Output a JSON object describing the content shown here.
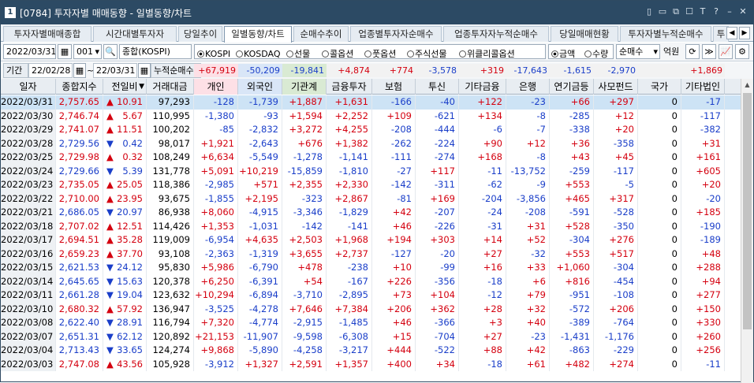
{
  "window": {
    "code": "1",
    "title": "[0784] 투자자별 매매동향 - 일별동향/차트",
    "controls": [
      "▯",
      "▭",
      "⧉",
      "☐",
      "T",
      "?",
      "–",
      "✕"
    ]
  },
  "tabs": [
    {
      "label": "투자자별매매종합",
      "active": false
    },
    {
      "label": "시간대별투자자",
      "active": false
    },
    {
      "label": "당일추이",
      "active": false
    },
    {
      "label": "일별동향/차트",
      "active": true
    },
    {
      "label": "순매수추이",
      "active": false
    },
    {
      "label": "업종별투자자순매수",
      "active": false
    },
    {
      "label": "업종투자자누적순매수",
      "active": false
    },
    {
      "label": "당일매매현황",
      "active": false
    },
    {
      "label": "투자자별누적순매수",
      "active": false
    },
    {
      "label": "투",
      "active": false
    }
  ],
  "tab_nav": {
    "prev": "◀",
    "next": "▶"
  },
  "toolbar": {
    "date": "2022/03/31",
    "calendar_icon": "▦",
    "sector_code": "001",
    "dropdown_icon": "▾",
    "search_icon": "🔍",
    "sector_name": "종합(KOSPI)",
    "market_radios": [
      {
        "label": "KOSPI",
        "checked": true
      },
      {
        "label": "KOSDAQ",
        "checked": false
      },
      {
        "label": "선물",
        "checked": false
      },
      {
        "label": "콜옵션",
        "checked": false
      },
      {
        "label": "풋옵션",
        "checked": false
      },
      {
        "label": "주식선물",
        "checked": false
      },
      {
        "label": "위클리콜옵션",
        "checked": false
      }
    ],
    "unit_radios": [
      {
        "label": "금액",
        "checked": true
      },
      {
        "label": "수량",
        "checked": false
      }
    ],
    "trade_select": "순매수",
    "unit_label": "억원",
    "refresh_icon": "⟳",
    "next_icon": "≫",
    "chart_icon": "📈",
    "settings_icon": "⚙"
  },
  "period": {
    "label": "기간",
    "from": "22/02/28",
    "tilde": "~",
    "to": "22/03/31",
    "cumulative_label": "누적순매수",
    "cumulative": [
      "+67,919",
      "-50,209",
      "-19,841",
      "+4,874",
      "+774",
      "-3,578",
      "+319",
      "-17,643",
      "-1,615",
      "-2,970",
      "",
      "+1,869"
    ]
  },
  "colors": {
    "up": "#d4000f",
    "down": "#1a3ec9",
    "selected_row": "#cde3f5",
    "titlebar": "#2c4a64"
  },
  "table": {
    "headers": [
      "일자",
      "종합지수",
      "전일비",
      "거래대금",
      "개인",
      "외국인",
      "기관계",
      "금융투자",
      "보험",
      "투신",
      "기타금융",
      "은행",
      "연기금등",
      "사모펀드",
      "국가",
      "기타법인"
    ],
    "sort_icon": "▼",
    "rows": [
      [
        "2022/03/31",
        "2,757.65",
        "▲",
        "10.91",
        "97,293",
        "-128",
        "-1,739",
        "+1,887",
        "+1,631",
        "-166",
        "-40",
        "+122",
        "-23",
        "+66",
        "+297",
        "0",
        "-17"
      ],
      [
        "2022/03/30",
        "2,746.74",
        "▲",
        "5.67",
        "110,995",
        "-1,380",
        "-93",
        "+1,594",
        "+2,252",
        "+109",
        "-621",
        "+134",
        "-8",
        "-285",
        "+12",
        "0",
        "-117"
      ],
      [
        "2022/03/29",
        "2,741.07",
        "▲",
        "11.51",
        "100,202",
        "-85",
        "-2,832",
        "+3,272",
        "+4,255",
        "-208",
        "-444",
        "-6",
        "-7",
        "-338",
        "+20",
        "0",
        "-382"
      ],
      [
        "2022/03/28",
        "2,729.56",
        "▼",
        "0.42",
        "98,017",
        "+1,921",
        "-2,643",
        "+676",
        "+1,382",
        "-262",
        "-224",
        "+90",
        "+12",
        "+36",
        "-358",
        "0",
        "+31"
      ],
      [
        "2022/03/25",
        "2,729.98",
        "▲",
        "0.32",
        "108,249",
        "+6,634",
        "-5,549",
        "-1,278",
        "-1,141",
        "-111",
        "-274",
        "+168",
        "-8",
        "+43",
        "+45",
        "0",
        "+161"
      ],
      [
        "2022/03/24",
        "2,729.66",
        "▼",
        "5.39",
        "131,778",
        "+5,091",
        "+10,219",
        "-15,859",
        "-1,810",
        "-27",
        "+117",
        "-11",
        "-13,752",
        "-259",
        "-117",
        "0",
        "+605"
      ],
      [
        "2022/03/23",
        "2,735.05",
        "▲",
        "25.05",
        "118,386",
        "-2,985",
        "+571",
        "+2,355",
        "+2,330",
        "-142",
        "-311",
        "-62",
        "-9",
        "+553",
        "-5",
        "0",
        "+20"
      ],
      [
        "2022/03/22",
        "2,710.00",
        "▲",
        "23.95",
        "93,675",
        "-1,855",
        "+2,195",
        "-323",
        "+2,867",
        "-81",
        "+169",
        "-204",
        "-3,856",
        "+465",
        "+317",
        "0",
        "-20"
      ],
      [
        "2022/03/21",
        "2,686.05",
        "▼",
        "20.97",
        "86,938",
        "+8,060",
        "-4,915",
        "-3,346",
        "-1,829",
        "+42",
        "-207",
        "-24",
        "-208",
        "-591",
        "-528",
        "0",
        "+185"
      ],
      [
        "2022/03/18",
        "2,707.02",
        "▲",
        "12.51",
        "114,426",
        "+1,353",
        "-1,031",
        "-142",
        "-141",
        "+46",
        "-226",
        "-31",
        "+31",
        "+528",
        "-350",
        "0",
        "-190"
      ],
      [
        "2022/03/17",
        "2,694.51",
        "▲",
        "35.28",
        "119,009",
        "-6,954",
        "+4,635",
        "+2,503",
        "+1,968",
        "+194",
        "+303",
        "+14",
        "+52",
        "-304",
        "+276",
        "0",
        "-189"
      ],
      [
        "2022/03/16",
        "2,659.23",
        "▲",
        "37.70",
        "93,108",
        "-2,363",
        "-1,319",
        "+3,655",
        "+2,737",
        "-127",
        "-20",
        "+27",
        "-32",
        "+553",
        "+517",
        "0",
        "+48"
      ],
      [
        "2022/03/15",
        "2,621.53",
        "▼",
        "24.12",
        "95,830",
        "+5,986",
        "-6,790",
        "+478",
        "-238",
        "+10",
        "-99",
        "+16",
        "+33",
        "+1,060",
        "-304",
        "0",
        "+288"
      ],
      [
        "2022/03/14",
        "2,645.65",
        "▼",
        "15.63",
        "120,378",
        "+6,250",
        "-6,391",
        "+54",
        "-167",
        "+226",
        "-356",
        "-18",
        "+6",
        "+816",
        "-454",
        "0",
        "+94"
      ],
      [
        "2022/03/11",
        "2,661.28",
        "▼",
        "19.04",
        "123,632",
        "+10,294",
        "-6,894",
        "-3,710",
        "-2,895",
        "+73",
        "+104",
        "-12",
        "+79",
        "-951",
        "-108",
        "0",
        "+277"
      ],
      [
        "2022/03/10",
        "2,680.32",
        "▲",
        "57.92",
        "136,947",
        "-3,525",
        "-4,278",
        "+7,646",
        "+7,384",
        "+206",
        "+362",
        "+28",
        "+32",
        "-572",
        "+206",
        "0",
        "+150"
      ],
      [
        "2022/03/08",
        "2,622.40",
        "▼",
        "28.91",
        "116,794",
        "+7,320",
        "-4,774",
        "-2,915",
        "-1,485",
        "+46",
        "-366",
        "+3",
        "+40",
        "-389",
        "-764",
        "0",
        "+330"
      ],
      [
        "2022/03/07",
        "2,651.31",
        "▼",
        "62.12",
        "120,892",
        "+21,153",
        "-11,907",
        "-9,598",
        "-6,308",
        "+15",
        "-704",
        "+27",
        "-23",
        "-1,431",
        "-1,176",
        "0",
        "+260"
      ],
      [
        "2022/03/04",
        "2,713.43",
        "▼",
        "33.65",
        "124,274",
        "+9,868",
        "-5,890",
        "-4,258",
        "-3,217",
        "+444",
        "-522",
        "+88",
        "+42",
        "-863",
        "-229",
        "0",
        "+256"
      ],
      [
        "2022/03/03",
        "2,747.08",
        "▲",
        "43.56",
        "105,928",
        "-3,912",
        "+1,327",
        "+2,591",
        "+1,357",
        "+400",
        "+34",
        "-18",
        "+61",
        "+482",
        "+274",
        "0",
        "-11"
      ]
    ]
  },
  "scrollbar": {
    "up_icon": "▲"
  }
}
